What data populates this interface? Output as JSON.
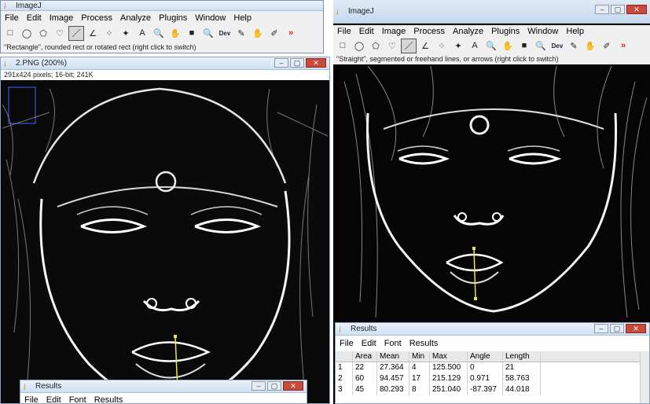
{
  "imagej_left": {
    "title": "ImageJ",
    "menu": [
      "File",
      "Edit",
      "Image",
      "Process",
      "Analyze",
      "Plugins",
      "Window",
      "Help"
    ],
    "status": "\"Rectangle\", rounded rect or rotated rect (right click to switch)"
  },
  "image_window": {
    "title": "2.PNG (200%)",
    "info": "291x424 pixels; 16-bit; 241K"
  },
  "imagej_right": {
    "title": "ImageJ",
    "menu": [
      "File",
      "Edit",
      "Image",
      "Process",
      "Analyze",
      "Plugins",
      "Window",
      "Help"
    ],
    "status": "\"Straight\", segmented or freehand lines, or arrows (right click to switch)"
  },
  "toolbar": {
    "icons": [
      "rectangle-tool-icon",
      "oval-tool-icon",
      "polygon-tool-icon",
      "freehand-tool-icon",
      "line-tool-icon",
      "angle-tool-icon",
      "point-tool-icon",
      "wand-tool-icon",
      "text-tool-icon",
      "magnifier-tool-icon",
      "hand-tool-icon",
      "color-picker-icon",
      "zoom-icon",
      "dev-icon",
      "pen-icon",
      "fill-icon",
      "pipette-icon",
      "more-tools-icon"
    ],
    "glyphs": [
      "□",
      "◯",
      "⬠",
      "♡",
      "／",
      "∠",
      "⁘",
      "✦",
      "A",
      "🔍",
      "✋",
      "■",
      "🔍",
      "Dev",
      "✎",
      "✋",
      "✐",
      "»"
    ]
  },
  "results_left": {
    "title": "Results",
    "menu": [
      "File",
      "Edit",
      "Font",
      "Results"
    ]
  },
  "results_right": {
    "title": "Results",
    "menu": [
      "File",
      "Edit",
      "Font",
      "Results"
    ],
    "columns": [
      "",
      "Area",
      "Mean",
      "Min",
      "Max",
      "Angle",
      "Length"
    ],
    "rows": [
      [
        "1",
        "22",
        "27.364",
        "4",
        "125.500",
        "0",
        "21"
      ],
      [
        "2",
        "60",
        "94.457",
        "17",
        "215.129",
        "0.971",
        "58.763"
      ],
      [
        "3",
        "45",
        "80.293",
        "8",
        "251.040",
        "-87.397",
        "44.018"
      ]
    ]
  },
  "colors": {
    "titlebar": "#cfe0f2",
    "selection_line": "#e8e84a",
    "face_edges": "#ffffff"
  }
}
